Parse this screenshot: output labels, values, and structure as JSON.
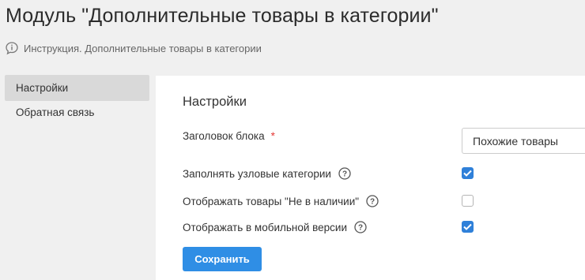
{
  "header": {
    "title": "Модуль \"Дополнительные товары в категории\"",
    "instruction_link": "Инструкция. Дополнительные товары в категории"
  },
  "sidebar": {
    "items": [
      {
        "label": "Настройки",
        "active": true
      },
      {
        "label": "Обратная связь",
        "active": false
      }
    ]
  },
  "settings": {
    "section_title": "Настройки",
    "block_title": {
      "label": "Заголовок блока",
      "required_mark": "*",
      "value": "Похожие товары"
    },
    "options": [
      {
        "label": "Заполнять узловые категории",
        "checked": true
      },
      {
        "label": "Отображать товары \"Не в наличии\"",
        "checked": false
      },
      {
        "label": "Отображать в мобильной версии",
        "checked": true
      }
    ],
    "save_label": "Сохранить"
  },
  "colors": {
    "accent": "#2f8ee5",
    "checkbox_checked": "#2f80d9",
    "required": "#e53935",
    "active_sidebar": "#d9d9d9"
  },
  "icons": {
    "instruction": "info-bubble-icon",
    "help": "question-circle-icon",
    "check": "checkmark-icon"
  }
}
